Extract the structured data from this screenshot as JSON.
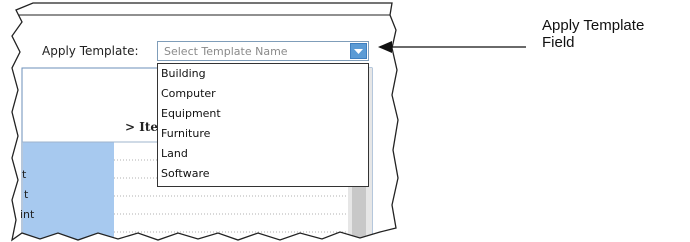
{
  "template_form": {
    "apply_label": "Apply Template:",
    "select_placeholder": "Select Template Name",
    "options": [
      "Building",
      "Computer",
      "Equipment",
      "Furniture",
      "Land",
      "Software"
    ]
  },
  "background_fragments": {
    "heading": "> Ite",
    "row_texts": [
      "t",
      "t",
      "int"
    ]
  },
  "callout": {
    "line1": "Apply Template",
    "line2": "Field"
  },
  "colors": {
    "accent_blue": "#5b9bd5",
    "column_blue": "#a7c9ef",
    "scroll_gray": "#c8c8c8",
    "frame_border": "#333333"
  }
}
